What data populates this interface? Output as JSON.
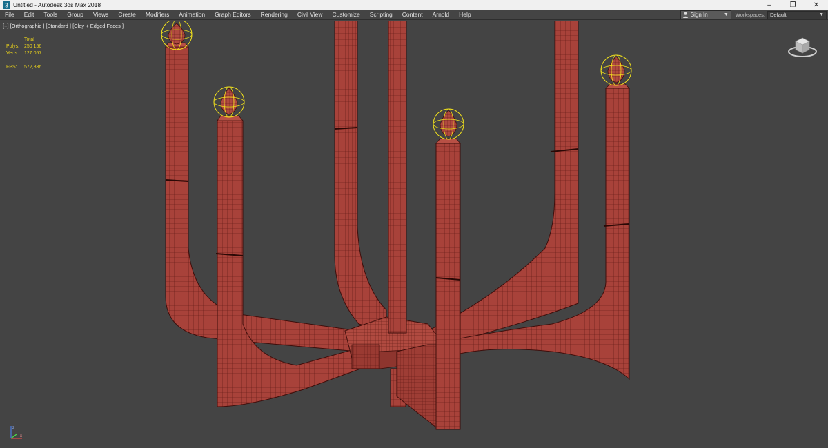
{
  "window": {
    "title": "Untitled - Autodesk 3ds Max 2018",
    "buttons": [
      "minimize",
      "restore",
      "close"
    ]
  },
  "menu": {
    "items": [
      "File",
      "Edit",
      "Tools",
      "Group",
      "Views",
      "Create",
      "Modifiers",
      "Animation",
      "Graph Editors",
      "Rendering",
      "Civil View",
      "Customize",
      "Scripting",
      "Content",
      "Arnold",
      "Help"
    ],
    "signin_label": "Sign In",
    "workspaces_label": "Workspaces:",
    "workspace_value": "Default"
  },
  "viewport": {
    "label": "[+] [Orthographic ] [Standard ] [Clay + Edged Faces ]",
    "stats": {
      "total_label": "Total",
      "polys_label": "Polys:",
      "polys_value": "250 156",
      "verts_label": "Verts:",
      "verts_value": "127 057",
      "fps_label": "FPS:",
      "fps_value": "572,836"
    }
  },
  "colors": {
    "viewport_bg": "#444444",
    "model_fill": "#a8423a",
    "wire": "#5a1612",
    "selection_gizmo": "#f2e21c",
    "stats_text": "#e8d11b"
  },
  "icons": {
    "app": "3ds-max-logo-icon",
    "user": "user-icon",
    "viewcube": "viewcube-icon",
    "axis": "axis-tripod-icon"
  }
}
